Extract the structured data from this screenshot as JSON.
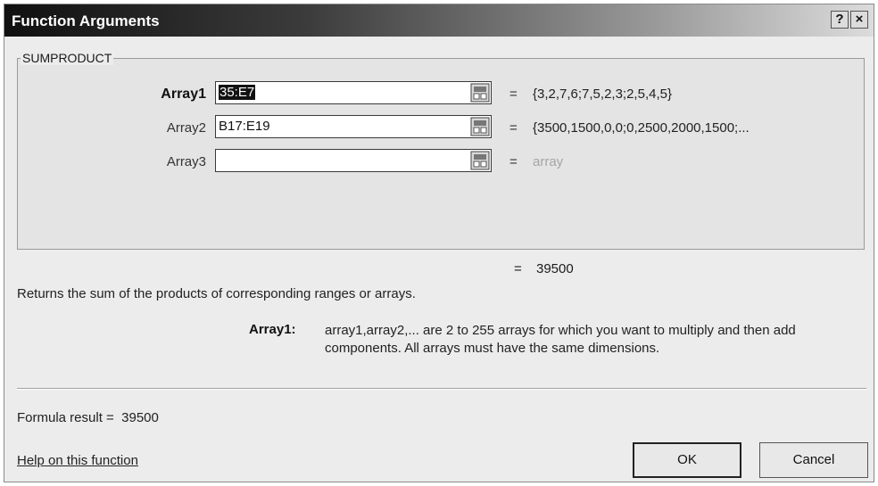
{
  "window": {
    "title": "Function Arguments",
    "help_glyph": "?",
    "close_glyph": "×"
  },
  "function": {
    "name": "SUMPRODUCT",
    "arguments": [
      {
        "label": "Array1",
        "value": "35:E7",
        "result": "{3,2,7,6;7,5,2,3;2,5,4,5}",
        "bold": true
      },
      {
        "label": "Array2",
        "value": "B17:E19",
        "result": "{3500,1500,0,0;0,2500,2000,1500;...",
        "bold": false
      },
      {
        "label": "Array3",
        "value": "",
        "result": "array",
        "bold": false
      }
    ],
    "equals": "=",
    "result_value": "39500",
    "description": "Returns the sum of the products of corresponding ranges or arrays.",
    "arg_help_label": "Array1:",
    "arg_help_text": "array1,array2,... are 2 to 255 arrays for which you want to multiply and then add components. All arrays must have the same dimensions."
  },
  "footer": {
    "formula_result_label": "Formula result =",
    "formula_result_value": "39500",
    "help_link": "Help on this function",
    "ok_label": "OK",
    "cancel_label": "Cancel"
  },
  "icons": {
    "collapse": "collapse-dialog-icon",
    "help": "help-icon",
    "close": "close-icon"
  }
}
